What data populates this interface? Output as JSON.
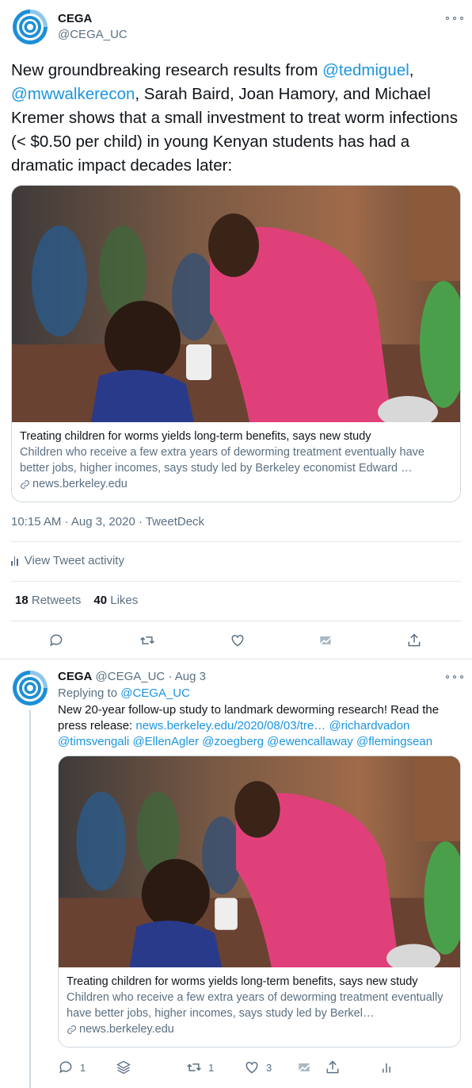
{
  "main_tweet": {
    "name": "CEGA",
    "handle": "@CEGA_UC",
    "text_parts": [
      {
        "t": "New groundbreaking research results from ",
        "link": false
      },
      {
        "t": "@tedmiguel",
        "link": true
      },
      {
        "t": ", ",
        "link": false
      },
      {
        "t": "@mwwalkerecon",
        "link": true
      },
      {
        "t": ", Sarah Baird, Joan Hamory, and Michael Kremer shows that a small investment to treat worm infections (< $0.50 per child) in young Kenyan students has had a dramatic impact decades later:",
        "link": false
      }
    ],
    "card": {
      "title": "Treating children for worms yields long-term benefits, says new study",
      "description": "Children who receive a few extra years of deworming treatment eventually have better jobs, higher incomes, says study led by Berkeley economist Edward …",
      "domain": "news.berkeley.edu"
    },
    "timestamp": "10:15 AM · Aug 3, 2020 · TweetDeck",
    "activity_label": "View Tweet activity",
    "retweets_count": "18",
    "retweets_label": "Retweets",
    "likes_count": "40",
    "likes_label": "Likes"
  },
  "reply_tweet": {
    "name": "CEGA",
    "handle": "@CEGA_UC",
    "date": "· Aug 3",
    "replying_prefix": "Replying to ",
    "replying_to": "@CEGA_UC",
    "text_parts": [
      {
        "t": "New 20-year follow-up study to landmark deworming research! Read the press release: ",
        "link": false
      },
      {
        "t": "news.berkeley.edu/2020/08/03/tre…",
        "link": true
      },
      {
        "t": " ",
        "link": false
      },
      {
        "t": "@richardvadon",
        "link": true
      },
      {
        "t": " ",
        "link": false
      },
      {
        "t": "@timsvengali",
        "link": true
      },
      {
        "t": " ",
        "link": false
      },
      {
        "t": "@EllenAgler",
        "link": true
      },
      {
        "t": " ",
        "link": false
      },
      {
        "t": "@zoegberg",
        "link": true
      },
      {
        "t": " ",
        "link": false
      },
      {
        "t": "@ewencallaway",
        "link": true
      },
      {
        "t": " ",
        "link": false
      },
      {
        "t": "@flemingsean",
        "link": true
      }
    ],
    "card": {
      "title": "Treating children for worms yields long-term benefits, says new study",
      "description": "Children who receive a few extra years of deworming treatment eventually have better jobs, higher incomes, says study led by Berkel…",
      "domain": "news.berkeley.edu"
    },
    "reply_count": "1",
    "retweet_count": "1",
    "like_count": "3"
  },
  "colors": {
    "link": "#1b95e0",
    "muted": "#5b7083",
    "divider": "#e1e8ed",
    "avatar_ring": "#1d8fd6"
  },
  "icons": [
    "more-icon",
    "link-icon",
    "activity-icon",
    "reply-icon",
    "retweet-icon",
    "like-icon",
    "tipjar-icon",
    "share-icon",
    "stack-icon"
  ]
}
